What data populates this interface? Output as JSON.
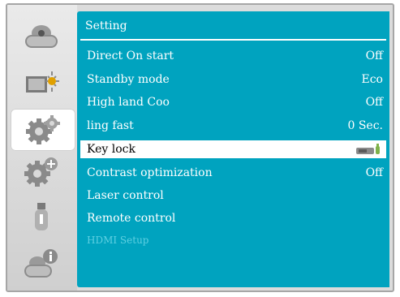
{
  "menu": {
    "title": "Setting",
    "items": [
      {
        "label": "Direct On start",
        "value": "Off"
      },
      {
        "label": "Standby mode",
        "value": "Eco"
      },
      {
        "label": "High land  Coo",
        "value": "Off"
      },
      {
        "label": "ling fast",
        "value": "0 Sec."
      },
      {
        "label": "Key lock",
        "value": ""
      },
      {
        "label": "Contrast optimization",
        "value": "Off"
      },
      {
        "label": "Laser control",
        "value": ""
      },
      {
        "label": "Remote control",
        "value": ""
      },
      {
        "label": "HDMI Setup",
        "value": ""
      }
    ]
  },
  "sidebar": {
    "tabs": [
      {
        "icon": "projector-icon"
      },
      {
        "icon": "image-adjust-icon"
      },
      {
        "icon": "gear-settings-icon"
      },
      {
        "icon": "gear-plus-icon"
      },
      {
        "icon": "usb-icon"
      },
      {
        "icon": "info-icon"
      }
    ]
  },
  "colors": {
    "panel": "#00a3bf",
    "disabled_text": "#5fd0e2",
    "selected_row": "#ffffff"
  }
}
